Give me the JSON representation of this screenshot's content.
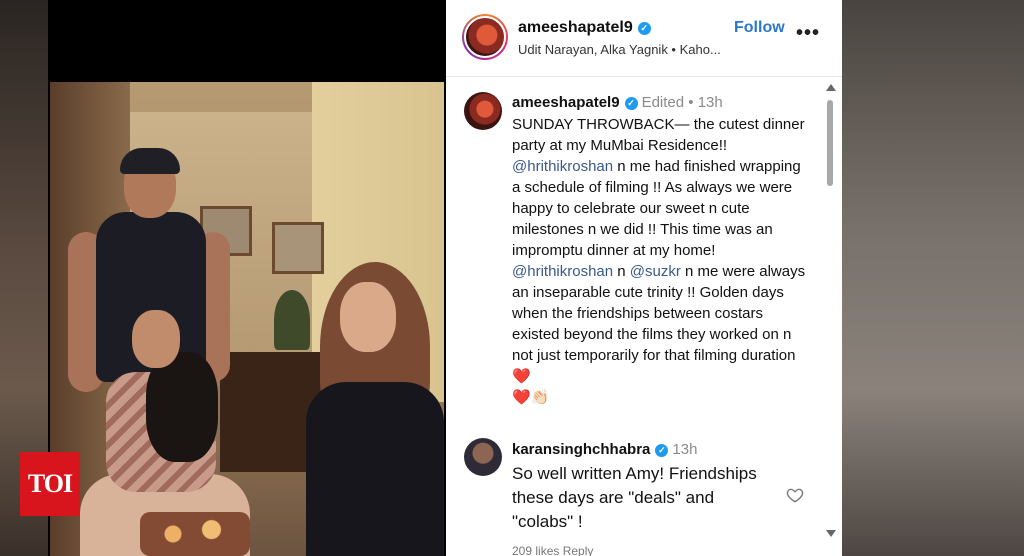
{
  "watermark": {
    "logo_text": "TOI"
  },
  "post": {
    "username": "ameeshapatel9",
    "music_subtitle": "Udit Narayan, Alka Yagnik • Kaho...",
    "follow_label": "Follow",
    "more_label": "•••"
  },
  "caption": {
    "username": "ameeshapatel9",
    "meta": "Edited • 13h",
    "line_a": "SUNDAY THROWBACK— the cutest dinner party at my MuMbai Residence!! ",
    "mention_1": "@hrithikroshan",
    "line_b": " n me had finished wrapping a schedule of filming !! As always we were happy to celebrate our sweet n cute milestones n we did !! This time was an impromptu dinner at my home! ",
    "mention_2": "@hrithikroshan",
    "line_c": " n ",
    "mention_3": "@suzkr",
    "line_d": " n me were always an inseparable cute trinity !! Golden days when the friendships between costars existed beyond the films they worked on n not just temporarily for that filming duration ",
    "emoji_1": "❤️",
    "emoji_2": "❤️",
    "emoji_3": "👏🏻"
  },
  "comment": {
    "username": "karansinghchhabra",
    "time": "13h",
    "text": "So well written Amy! Friendships these days are \"deals\" and \"colabs\" !",
    "partial_text": "209 likes   Reply"
  },
  "icons": {
    "verified": "verified-badge-icon",
    "like": "heart-outline-icon",
    "more": "more-horizontal-icon"
  },
  "colors": {
    "accent": "#2b78c9",
    "verified": "#1d9bf0",
    "toi_red": "#d8141c",
    "mention": "#3b5a8c"
  }
}
